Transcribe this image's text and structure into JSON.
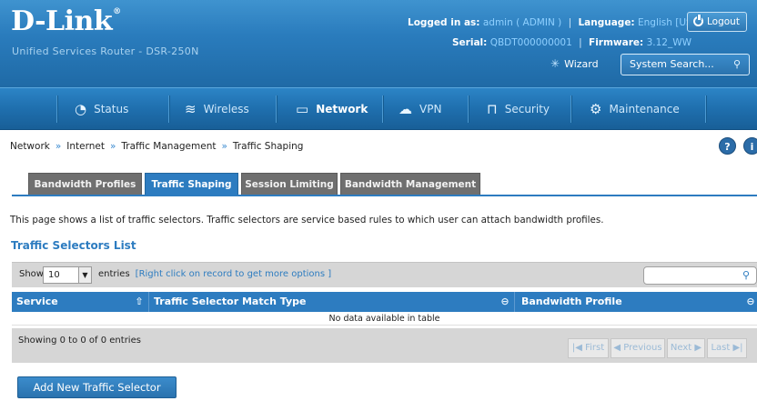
{
  "header": {
    "logo": "D-Link",
    "logo_mark": "®",
    "subtitle": "Unified Services Router - DSR-250N",
    "logged_in_label": "Logged in as:",
    "logged_in_value": "admin ( ADMIN )",
    "language_label": "Language:",
    "language_value": "English [US]",
    "serial_label": "Serial:",
    "serial_value": "QBDT000000001",
    "firmware_label": "Firmware:",
    "firmware_value": "3.12_WW",
    "logout_label": "Logout",
    "wizard_label": "Wizard",
    "search_placeholder": "System Search..."
  },
  "nav": {
    "items": [
      {
        "label": "Status",
        "icon": "dashboard-gauge-icon"
      },
      {
        "label": "Wireless",
        "icon": "wifi-icon"
      },
      {
        "label": "Network",
        "icon": "monitor-icon",
        "active": true
      },
      {
        "label": "VPN",
        "icon": "cloud-lock-icon"
      },
      {
        "label": "Security",
        "icon": "padlock-icon"
      },
      {
        "label": "Maintenance",
        "icon": "gears-icon"
      }
    ]
  },
  "breadcrumb": [
    "Network",
    "Internet",
    "Traffic Management",
    "Traffic Shaping"
  ],
  "breadcrumb_sep": "»",
  "tabs": [
    {
      "label": "Bandwidth Profiles"
    },
    {
      "label": "Traffic Shaping",
      "active": true
    },
    {
      "label": "Session Limiting"
    },
    {
      "label": "Bandwidth Management"
    }
  ],
  "description": "This page shows a list of traffic selectors. Traffic selectors are service based rules to which user can attach bandwidth profiles.",
  "section_title": "Traffic Selectors List",
  "table": {
    "show_label": "Show",
    "page_length": "10",
    "entries_label": "entries",
    "hint": "[Right click on record to get more options ]",
    "columns": [
      "Service",
      "Traffic Selector Match Type",
      "Bandwidth Profile"
    ],
    "empty_message": "No data available in table",
    "info": "Showing 0 to 0 of 0 entries",
    "pager": {
      "first": "First",
      "previous": "Previous",
      "next": "Next",
      "last": "Last"
    }
  },
  "add_button_label": "Add New Traffic Selector",
  "colors": {
    "brand_blue": "#2d7cc0",
    "header_blue": "#2a7cbd",
    "tab_inactive": "#6f6f6f",
    "toolbar_gray": "#d6d6d6",
    "link_blue": "#2d7cc0"
  }
}
